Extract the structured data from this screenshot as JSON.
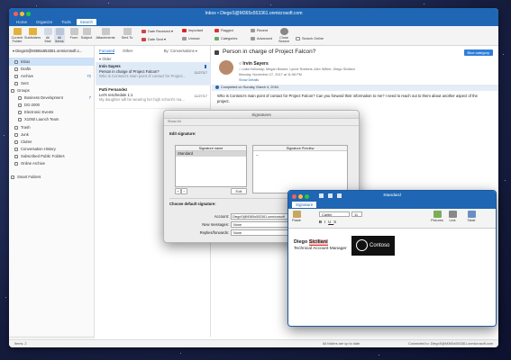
{
  "window": {
    "title": "Inbox • DiegoS@M365x553361.onmicrosoft.com",
    "tabs": [
      "Home",
      "Organize",
      "Tools",
      "Search"
    ],
    "active_tab": "Search"
  },
  "ribbon": {
    "current_folder": "Current\nFolder",
    "subfolders": "Subfolders",
    "all_mail": "All\nMail",
    "all_items": "All\nItems",
    "from": "From",
    "subject": "Subject",
    "attachments": "Attachments",
    "sent_to": "Sent To",
    "date_received": "Date Received",
    "date_sent": "Date Sent",
    "important": "Important",
    "unread": "Unread",
    "flagged": "Flagged",
    "categories": "Categories",
    "recent": "Recent",
    "advanced": "Advanced",
    "close_search": "Close\nSearch",
    "search_online": "Search Online"
  },
  "folders": {
    "account": "DiegoS@M365x553361.onmicrosoft.c...",
    "items": [
      {
        "label": "Inbox",
        "count": "",
        "selected": true
      },
      {
        "label": "Drafts",
        "count": ""
      },
      {
        "label": "Archive",
        "count": "72"
      },
      {
        "label": "Sent",
        "count": ""
      },
      {
        "label": "Groups",
        "count": ""
      },
      {
        "label": "Business Development",
        "count": "7"
      },
      {
        "label": "DG-2000",
        "count": ""
      },
      {
        "label": "Electronic Events",
        "count": ""
      },
      {
        "label": "X1050 Launch Team",
        "count": ""
      },
      {
        "label": "Trash",
        "count": ""
      },
      {
        "label": "Junk",
        "count": ""
      },
      {
        "label": "Clutter",
        "count": ""
      },
      {
        "label": "Conversation History",
        "count": ""
      },
      {
        "label": "Subscribed Public Folders",
        "count": ""
      },
      {
        "label": "Online Archive",
        "count": ""
      },
      {
        "label": "Smart Folders",
        "count": ""
      }
    ]
  },
  "message_list": {
    "tab_focused": "Focused",
    "tab_other": "Other",
    "sort": "By: Conversations",
    "group": "Older",
    "messages": [
      {
        "sender": "Irvin Sayers",
        "subject": "Person in charge of Project Falcon?",
        "date": "11/27/17",
        "preview": "Who is Contoso's main point of contact for Project..."
      },
      {
        "sender": "Patti Fernandez",
        "subject": "Let's reschedule 1:1",
        "date": "11/27/17",
        "preview": "My daughter will be wearing her high school's ma..."
      }
    ]
  },
  "reading": {
    "subject": "Person in charge of Project Falcon?",
    "category": "Blue category",
    "sender": "Irvin Sayers",
    "to": "Lidia Holloway;  Megan Bowen;  Lynne Robbins;  Alex Wilber;  Diego Siciliani",
    "date": "Monday, November 27, 2017 at 11:56 PM",
    "show_details": "Show Details",
    "completed": "Completed on Sunday, March 4, 2018.",
    "body": "Who is Contoso's main point of contact for Project Falcon? Can you forward their information to me? I need to reach out to them about another aspect of the project."
  },
  "signatures_dialog": {
    "title": "Signatures",
    "show_all": "Show All",
    "edit_heading": "Edit signature:",
    "col_name": "Signature name",
    "col_preview": "Signature Preview",
    "sig_item": "Standard",
    "preview_text": "--",
    "add": "+",
    "remove": "−",
    "edit": "Edit",
    "default_heading": "Choose default signature:",
    "account_label": "Account:",
    "account_value": "DiegoS@M365x553361.onmicrosoft",
    "new_messages_label": "New messages:",
    "new_messages_value": "None",
    "replies_label": "Replies/forwards:",
    "replies_value": "None"
  },
  "compose": {
    "title": "Standard",
    "tab": "Signature",
    "paste": "Paste",
    "font": "Calibri",
    "size": "11",
    "pictures": "Pictures",
    "link": "Link",
    "table": "Table",
    "sig_name_first": "Diego",
    "sig_name_last": "Siciliani",
    "sig_title": "Technical Account Manager",
    "logo_text": "Contoso"
  },
  "status": {
    "items": "Items: 2",
    "sync": "All folders are up to date.",
    "connected": "Connected to: DiegoS@M365x553361.onmicrosoft.com"
  },
  "colors": {
    "accent": "#1f66b4",
    "blue_category": "#2f7fd8"
  }
}
